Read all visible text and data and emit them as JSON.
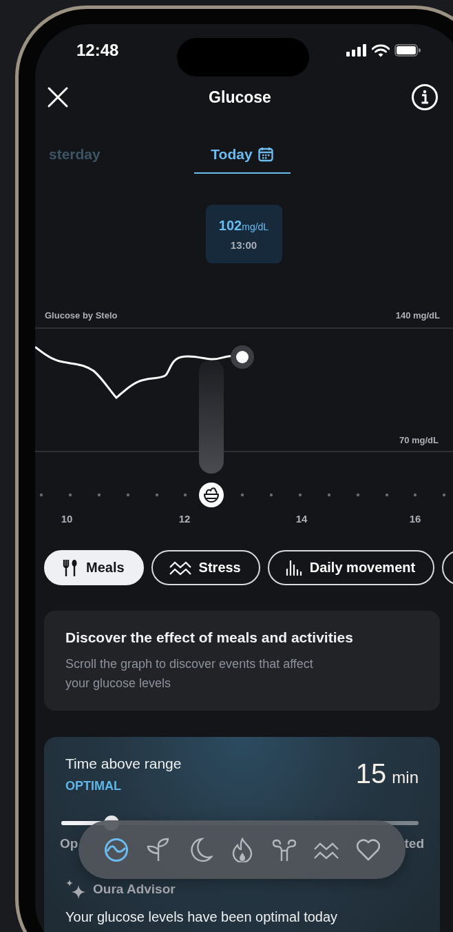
{
  "status_bar": {
    "time": "12:48"
  },
  "header": {
    "title": "Glucose"
  },
  "day_tabs": [
    {
      "label": "sterday",
      "selected": false
    },
    {
      "label": "Today",
      "selected": true
    }
  ],
  "reading": {
    "value": "102",
    "unit": "mg/dL",
    "time": "13:00"
  },
  "chart": {
    "source": "Glucose by Stelo",
    "upper_label": "140 mg/dL",
    "lower_label": "70 mg/dL",
    "x_labels": [
      "10",
      "12",
      "14",
      "16"
    ]
  },
  "filters": [
    {
      "label": "Meals",
      "kind": "meals",
      "selected": true
    },
    {
      "label": "Stress",
      "kind": "stress",
      "selected": false
    },
    {
      "label": "Daily movement",
      "kind": "movement",
      "selected": false
    }
  ],
  "info_card": {
    "title": "Discover the effect of meals and activities",
    "text": "Scroll the graph to discover events that affect your glucose levels"
  },
  "metric": {
    "title": "Time above range",
    "status": "OPTIMAL",
    "value": "15",
    "unit": "min",
    "level": 0.14,
    "left_label": "Op",
    "right_label": "ted"
  },
  "advisor": {
    "title": "Oura Advisor",
    "text": "Your glucose levels have been optimal today"
  },
  "nav": [
    {
      "kind": "glucose",
      "selected": true
    },
    {
      "kind": "sprout",
      "selected": false
    },
    {
      "kind": "moon",
      "selected": false
    },
    {
      "kind": "flame",
      "selected": false
    },
    {
      "kind": "ribbon",
      "selected": false
    },
    {
      "kind": "waves",
      "selected": false
    },
    {
      "kind": "heart",
      "selected": false
    }
  ]
}
